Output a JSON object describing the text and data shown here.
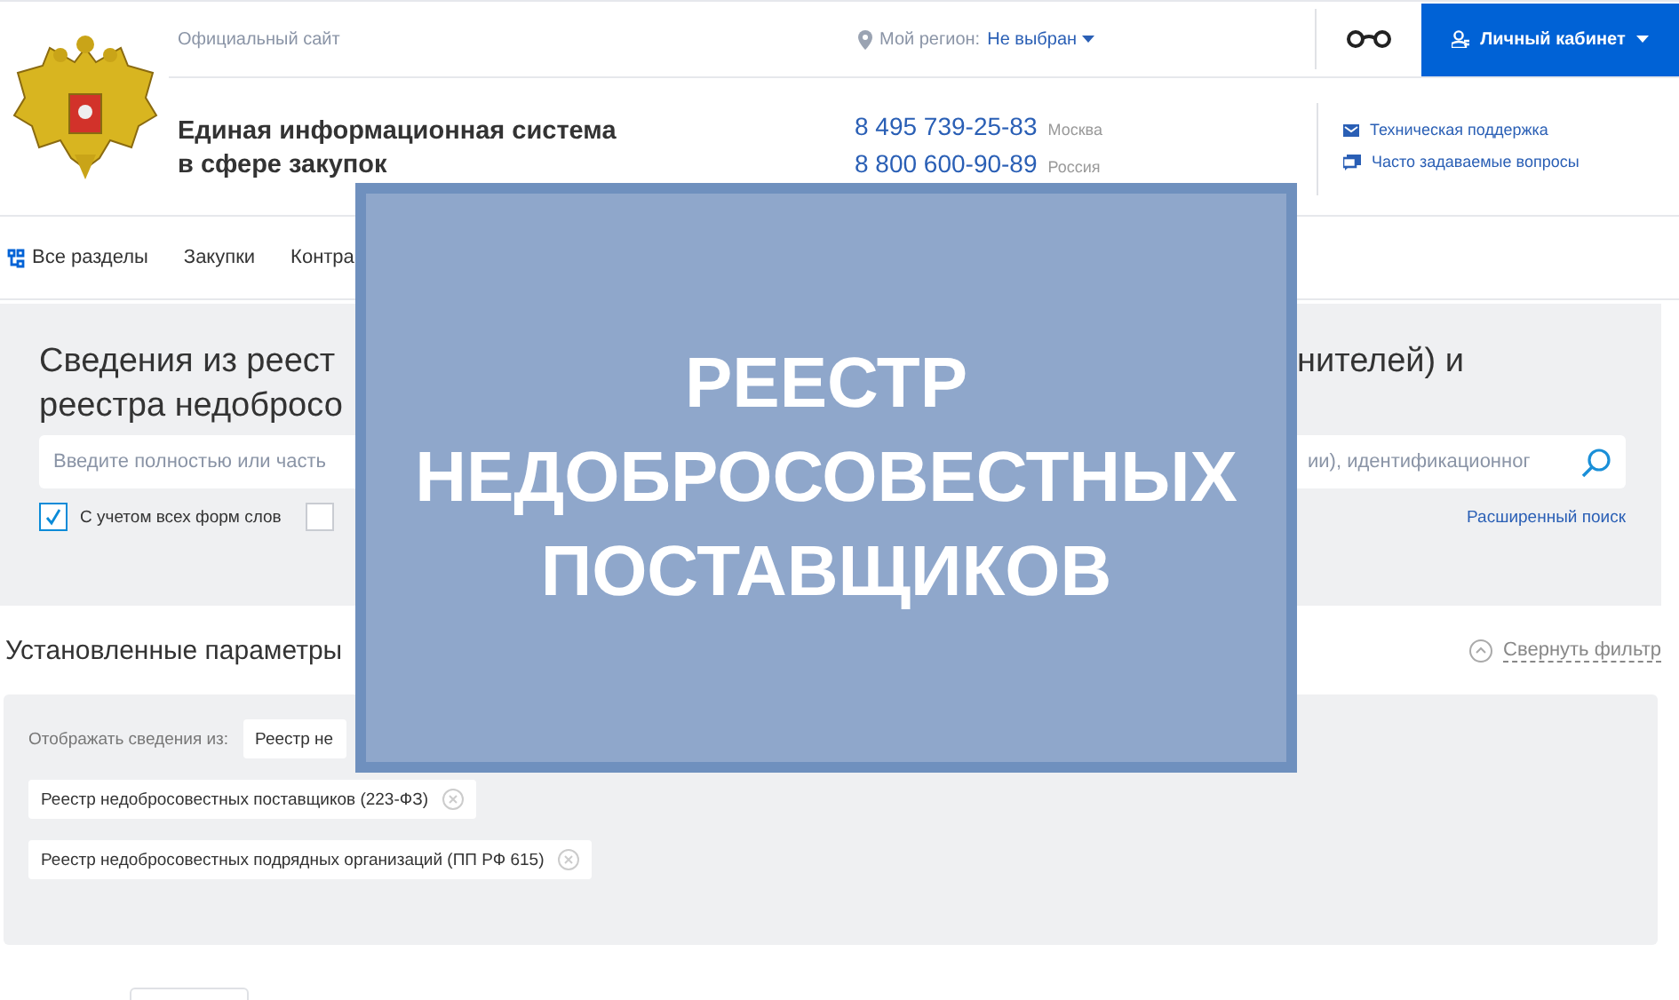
{
  "header": {
    "official_site": "Официальный сайт",
    "region_label": "Мой регион:",
    "region_value": "Не выбран",
    "account_button": "Личный кабинет",
    "title": "Единая информационная система в сфере закупок",
    "phones": [
      {
        "number": "8 495 739-25-83",
        "city": "Москва"
      },
      {
        "number": "8 800 600-90-89",
        "city": "Россия"
      }
    ],
    "support_links": [
      {
        "kind": "mail",
        "label": "Техническая поддержка"
      },
      {
        "kind": "chat",
        "label": "Часто задаваемые вопросы"
      }
    ]
  },
  "nav": [
    {
      "label": "Все разделы",
      "kind": "all"
    },
    {
      "label": "Закупки",
      "kind": "plain"
    },
    {
      "label": "Контра",
      "kind": "plain"
    }
  ],
  "search": {
    "heading_left": [
      "Сведения из реест",
      "реестра недобросо"
    ],
    "heading_right": "нителей) и",
    "placeholder": "Введите полностью или часть",
    "placeholder_tail": "ии), идентификационног",
    "options": [
      {
        "label": "С учетом всех форм слов",
        "checked": true
      },
      {
        "checked": false
      }
    ],
    "advanced_link": "Расширенный поиск"
  },
  "params": {
    "heading": "Установленные параметры",
    "collapse_link": "Свернуть фильтр",
    "show_label": "Отображать сведения из:",
    "chips": [
      {
        "label": "Реестр не",
        "removable": false
      },
      {
        "label": "Реестр недобросовестных поставщиков (223-ФЗ)",
        "removable": true
      },
      {
        "label": "Реестр недобросовестных подрядных организаций (ПП РФ 615)",
        "removable": true
      }
    ]
  },
  "banner": {
    "lines": [
      "РЕЕСТР",
      "НЕДОБРОСОВЕСТНЫХ",
      "ПОСТАВЩИКОВ"
    ]
  }
}
